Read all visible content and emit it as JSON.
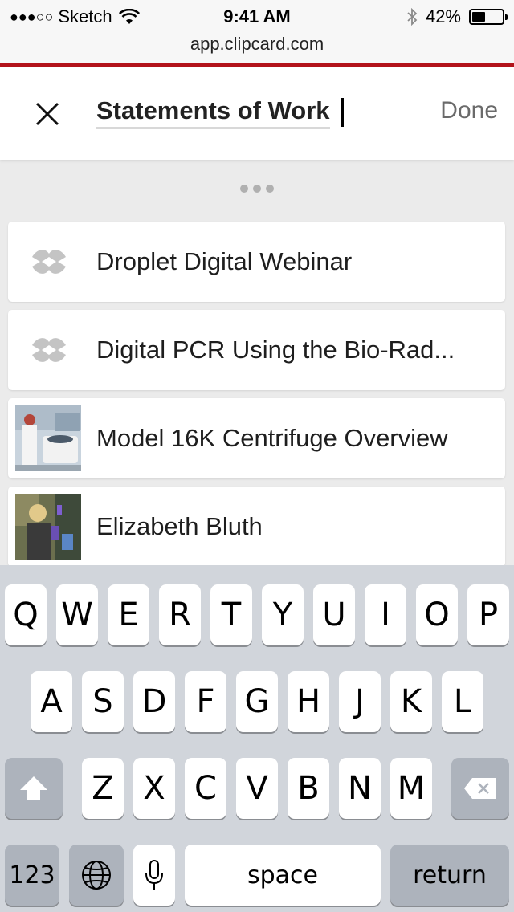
{
  "status_bar": {
    "signal": "●●●○○",
    "carrier": "Sketch",
    "time": "9:41 AM",
    "battery_pct": "42%",
    "battery_level": 0.42
  },
  "url_bar": {
    "url": "app.clipcard.com"
  },
  "header": {
    "title": "Statements of Work",
    "done_label": "Done"
  },
  "list": {
    "items": [
      {
        "label": "Droplet Digital Webinar",
        "icon": "clipcard-logo-icon"
      },
      {
        "label": "Digital PCR Using the Bio-Rad...",
        "icon": "clipcard-logo-icon"
      },
      {
        "label": "Model 16K Centrifuge Overview",
        "icon": "centrifuge-thumbnail"
      },
      {
        "label": "Elizabeth Bluth",
        "icon": "person-thumbnail"
      }
    ]
  },
  "keyboard": {
    "row1": [
      "Q",
      "W",
      "E",
      "R",
      "T",
      "Y",
      "U",
      "I",
      "O",
      "P"
    ],
    "row2": [
      "A",
      "S",
      "D",
      "F",
      "G",
      "H",
      "J",
      "K",
      "L"
    ],
    "row3": [
      "Z",
      "X",
      "C",
      "V",
      "B",
      "N",
      "M"
    ],
    "numbers_label": "123",
    "space_label": "space",
    "return_label": "return"
  },
  "colors": {
    "accent_red": "#b3131b",
    "keyboard_bg": "#d1d5db"
  }
}
